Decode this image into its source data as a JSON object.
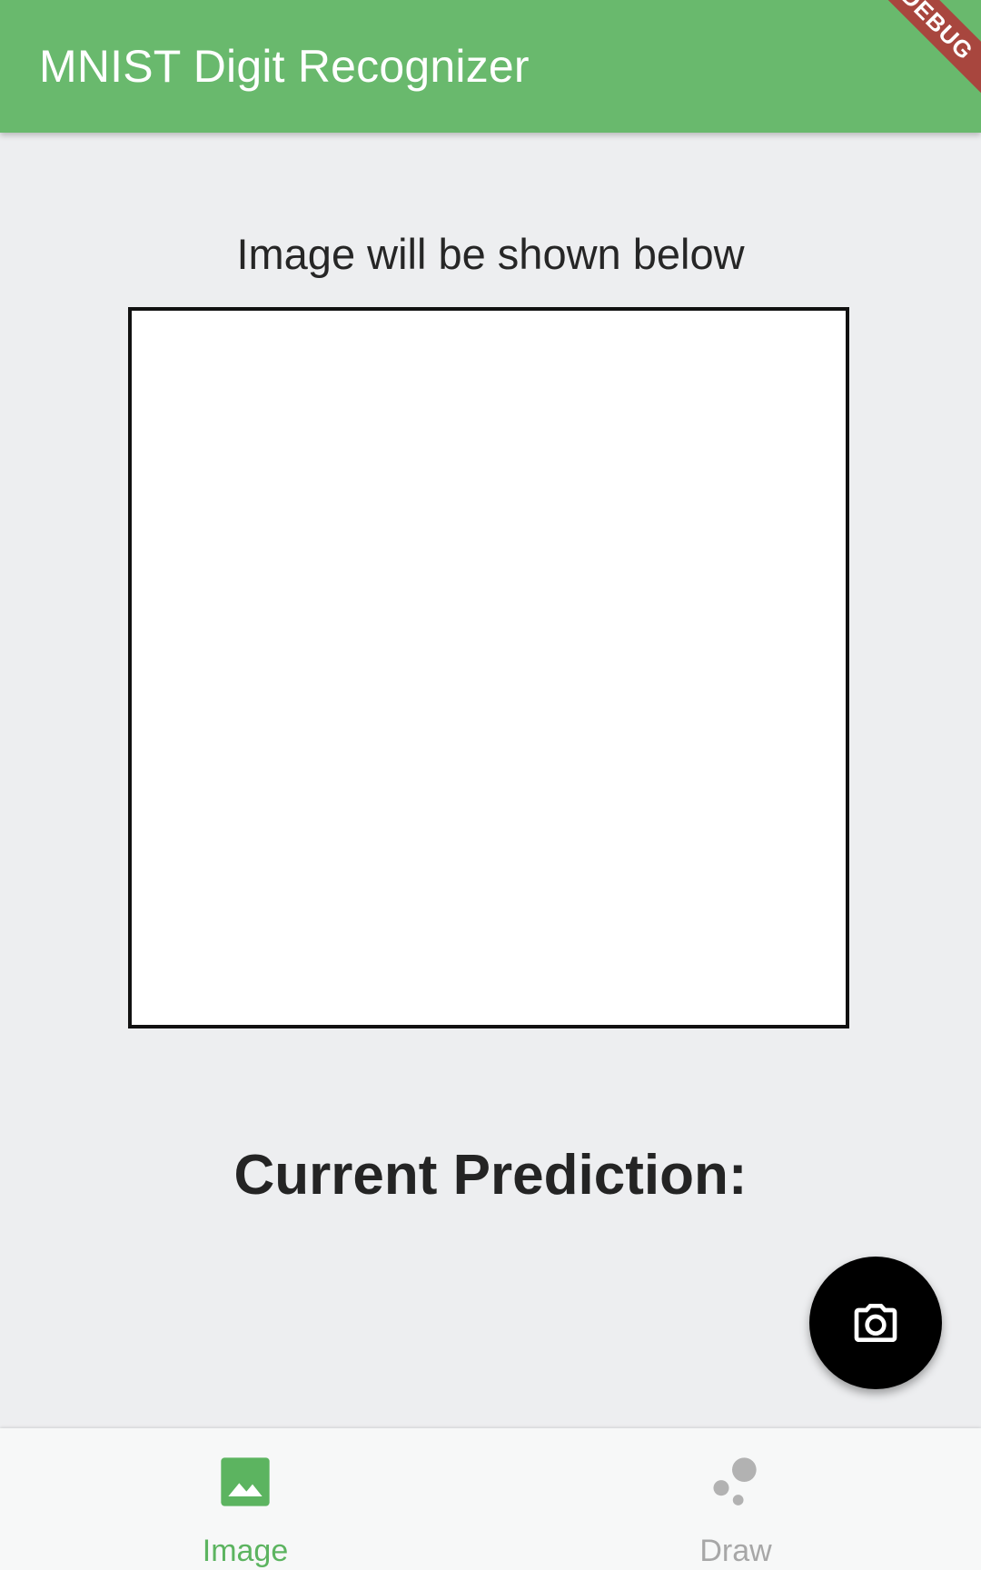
{
  "app_bar": {
    "title": "MNIST Digit Recognizer",
    "debug_banner": "DEBUG",
    "background_color": "#69b96d"
  },
  "main": {
    "caption": "Image will be shown below",
    "prediction_label": "Current Prediction:"
  },
  "fab": {
    "icon": "camera-icon",
    "background_color": "#000000"
  },
  "bottom_nav": {
    "items": [
      {
        "label": "Image",
        "icon": "image-icon",
        "active": true,
        "color": "#5cb460"
      },
      {
        "label": "Draw",
        "icon": "bubbles-icon",
        "active": false,
        "color": "#a7a7a7"
      }
    ]
  }
}
